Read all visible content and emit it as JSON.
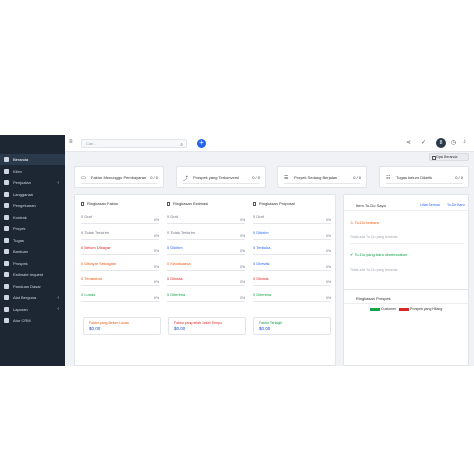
{
  "sidebar": {
    "items": [
      {
        "label": "Beranda",
        "active": true,
        "chevron": false
      },
      {
        "label": "Klien",
        "active": false,
        "chevron": false
      },
      {
        "label": "Penjualan",
        "active": false,
        "chevron": true
      },
      {
        "label": "Langganan",
        "active": false,
        "chevron": false
      },
      {
        "label": "Pengeluaran",
        "active": false,
        "chevron": false
      },
      {
        "label": "Kontrak",
        "active": false,
        "chevron": false
      },
      {
        "label": "Proyek",
        "active": false,
        "chevron": false
      },
      {
        "label": "Tugas",
        "active": false,
        "chevron": false
      },
      {
        "label": "Bantuan",
        "active": false,
        "chevron": false
      },
      {
        "label": "Prospek",
        "active": false,
        "chevron": false
      },
      {
        "label": "Estimate request",
        "active": false,
        "chevron": false
      },
      {
        "label": "Panduan Dasar",
        "active": false,
        "chevron": false
      },
      {
        "label": "Alat Berguna",
        "active": false,
        "chevron": true
      },
      {
        "label": "Laporan",
        "active": false,
        "chevron": true
      },
      {
        "label": "Atur CRM",
        "active": false,
        "chevron": false
      }
    ]
  },
  "topbar": {
    "search_placeholder": "Cari...",
    "avatar_initial": "8"
  },
  "dashboard_button_label": "Opsi Beranda",
  "stats": [
    {
      "icon": "invoice-icon",
      "label": "Faktur Menunggu Pembayaran",
      "value": "0 / 0"
    },
    {
      "icon": "trend-icon",
      "label": "Prospek yang Terkonversi",
      "value": "0 / 0"
    },
    {
      "icon": "sliders-icon",
      "label": "Proyek Sedang Berjalan",
      "value": "0 / 0"
    },
    {
      "icon": "tasks-icon",
      "label": "Tugas belum Diketik",
      "value": "0 / 0"
    }
  ],
  "overview": {
    "columns": [
      {
        "title": "Ringkasan Faktur",
        "rows": [
          {
            "label": "0 Draf",
            "pct": "0%",
            "color": "#6b7280"
          },
          {
            "label": "0 Tidak Terkirim",
            "pct": "0%",
            "color": "#6b7280"
          },
          {
            "label": "0 Belum Dibayar",
            "pct": "0%",
            "color": "#dc2626"
          },
          {
            "label": "0 Dibayar Sebagian",
            "pct": "0%",
            "color": "#ea580c"
          },
          {
            "label": "0 Terlambat",
            "pct": "0%",
            "color": "#ea580c"
          },
          {
            "label": "0 Lunas",
            "pct": "0%",
            "color": "#16a34a"
          }
        ]
      },
      {
        "title": "Ringkasan Estimasi",
        "rows": [
          {
            "label": "0 Draf",
            "pct": "0%",
            "color": "#6b7280"
          },
          {
            "label": "0 Tidak Terkirim",
            "pct": "0%",
            "color": "#6b7280"
          },
          {
            "label": "0 Dikirim",
            "pct": "0%",
            "color": "#2563eb"
          },
          {
            "label": "0 Kedaluarsa",
            "pct": "0%",
            "color": "#ea580c"
          },
          {
            "label": "0 Ditolak",
            "pct": "0%",
            "color": "#dc2626"
          },
          {
            "label": "0 Diterima",
            "pct": "0%",
            "color": "#16a34a"
          }
        ]
      },
      {
        "title": "Ringkasan Proposal",
        "rows": [
          {
            "label": "0 Draf",
            "pct": "0%",
            "color": "#6b7280"
          },
          {
            "label": "0 Dikirim",
            "pct": "0%",
            "color": "#2563eb"
          },
          {
            "label": "0 Terbuka",
            "pct": "0%",
            "color": "#2563eb"
          },
          {
            "label": "0 Direvisi",
            "pct": "0%",
            "color": "#2563eb"
          },
          {
            "label": "0 Ditolak",
            "pct": "0%",
            "color": "#dc2626"
          },
          {
            "label": "0 Diterima",
            "pct": "0%",
            "color": "#16a34a"
          }
        ]
      }
    ],
    "totals": [
      {
        "label": "Faktur yang Belum Lunas",
        "value": "$0.00",
        "color": "#ea580c"
      },
      {
        "label": "Faktur yang telah Jatuh Tempo",
        "value": "$0.00",
        "color": "#dc2626"
      },
      {
        "label": "Faktur Tertagih",
        "value": "$0.00",
        "color": "#16a34a"
      }
    ]
  },
  "todo": {
    "title": "Item To-Do Saya",
    "link_all": "Lihat Semua",
    "link_new": "To-Do Baru",
    "latest_label": "To-Do terbaru",
    "latest_empty": "Tidak ada To-Do yang tersedia",
    "done_label": "To-Do yang baru diselesaikan",
    "done_empty": "Tidak ada To-Do yang tersedia"
  },
  "leads": {
    "title": "Ringkasan Prospek",
    "legend": [
      {
        "label": "Customer",
        "color": "#16a34a"
      },
      {
        "label": "Prospek yang Hilang",
        "color": "#dc2626"
      }
    ]
  }
}
